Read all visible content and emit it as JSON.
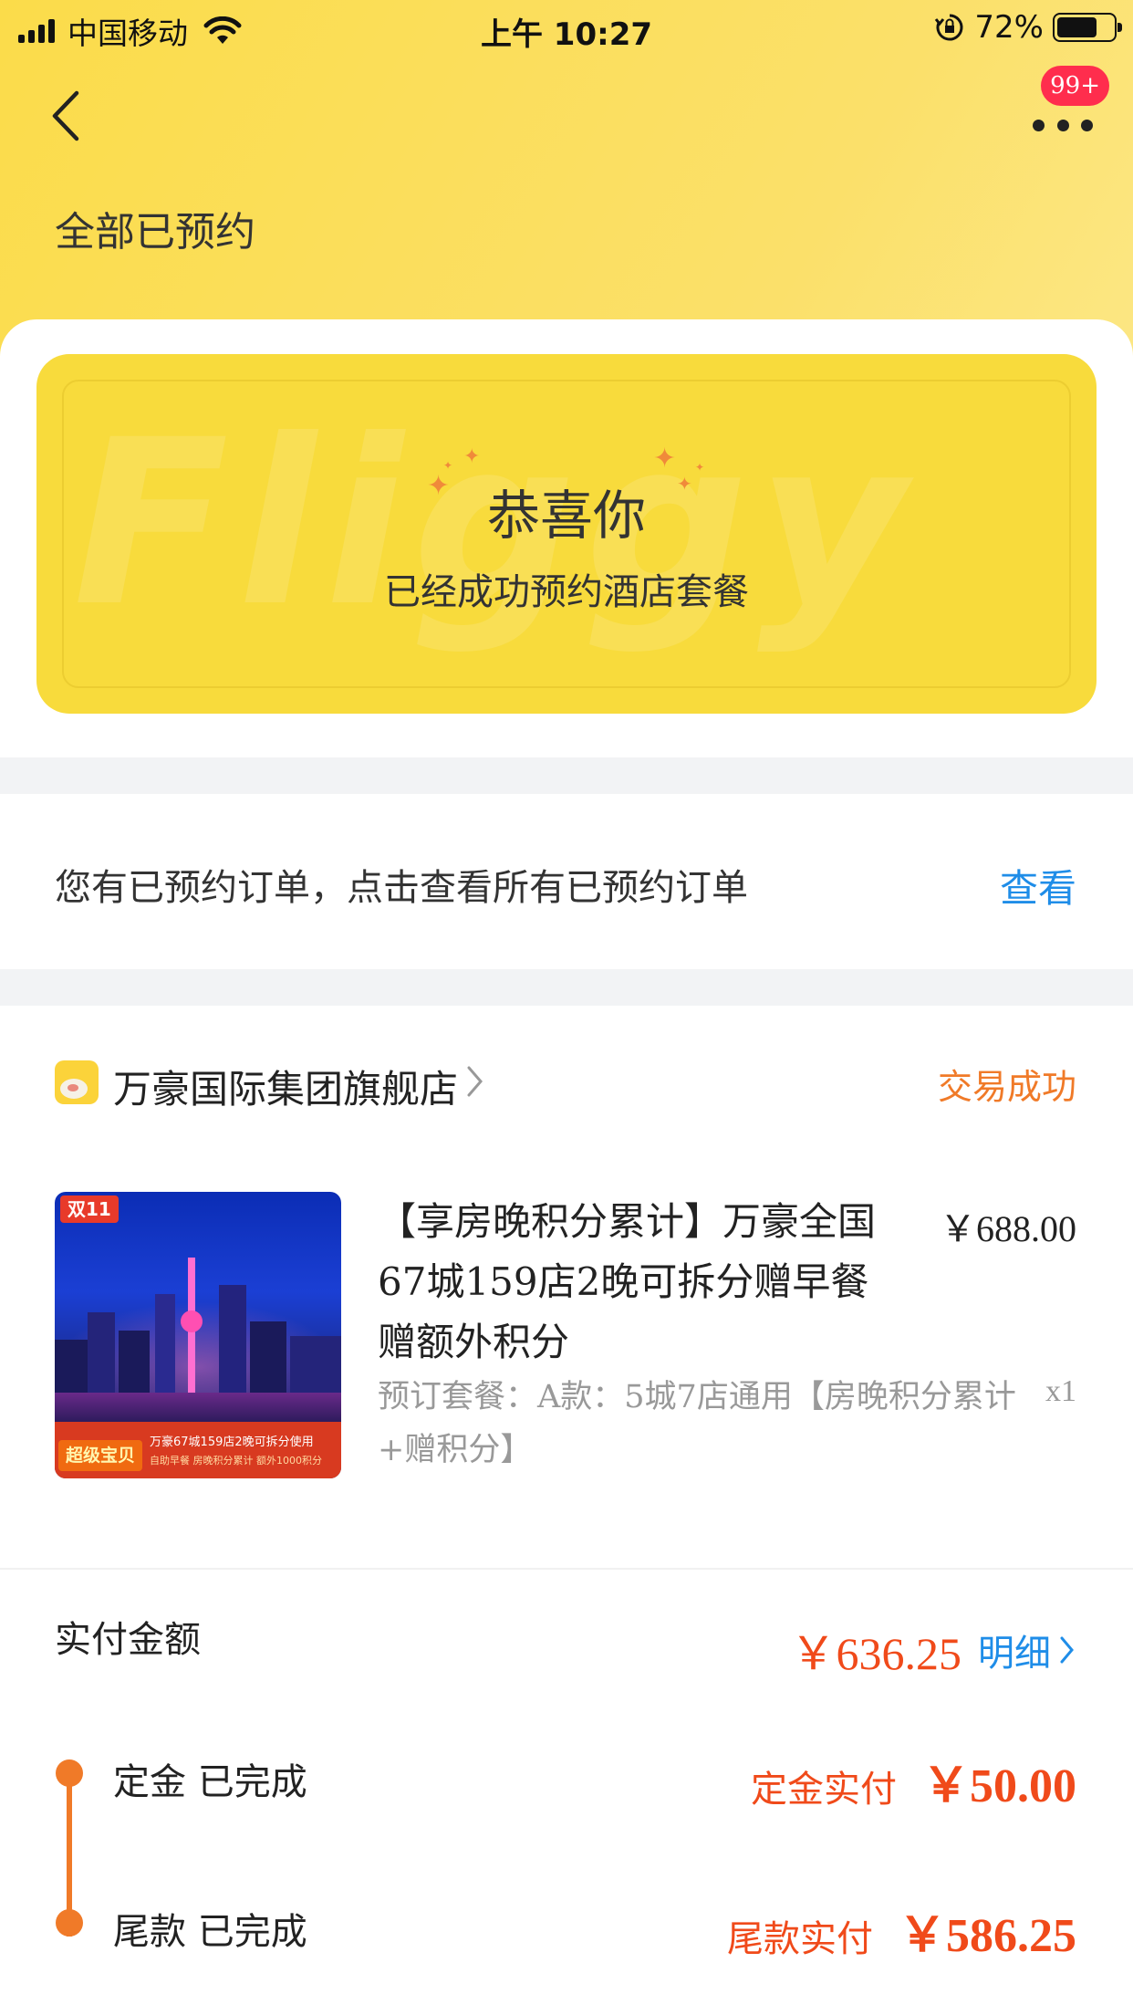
{
  "status_bar": {
    "carrier": "中国移动",
    "time": "上午 10:27",
    "battery_percent": "72%"
  },
  "header": {
    "badge": "99+",
    "title": "全部已预约"
  },
  "congrats": {
    "title": "恭喜你",
    "subtitle": "已经成功预约酒店套餐",
    "watermark": "Fliggy"
  },
  "notice": {
    "text": "您有已预约订单，点击查看所有已预约订单",
    "link": "查看"
  },
  "order": {
    "store_name": "万豪国际集团旗舰店",
    "status": "交易成功",
    "product": {
      "image_tag": "双11",
      "image_badge": "超级宝贝",
      "image_line1": "万豪67城159店2晚可拆分使用",
      "image_line2": "自助早餐 房晚积分累计 额外1000积分",
      "title": "【享房晚积分累计】万豪全国67城159店2晚可拆分赠早餐赠额外积分",
      "price": "￥688.00",
      "spec": "预订套餐：A款：5城7店通用【房晚积分累计+赠积分】",
      "qty": "x1"
    },
    "paid_label": "实付金额",
    "paid_amount": "￥636.25",
    "detail_link": "明细",
    "steps": [
      {
        "label": "定金 已完成",
        "pay_label": "定金实付",
        "amount": "￥50.00"
      },
      {
        "label": "尾款 已完成",
        "pay_label": "尾款实付",
        "amount": "￥586.25"
      }
    ]
  },
  "colors": {
    "header_yellow": "#fbdc4a",
    "card_yellow": "#f8db3c",
    "accent_orange": "#f07a28",
    "price_red": "#f04a1a",
    "link_blue": "#1f8de8",
    "badge_red": "#ff2d4d"
  }
}
